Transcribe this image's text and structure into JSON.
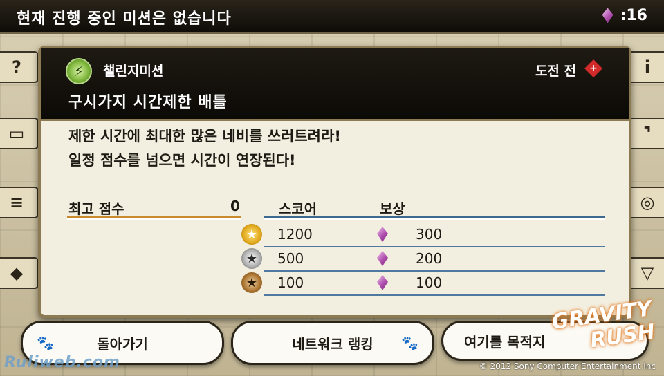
{
  "top_bar": {
    "message": "현재 진행 중인 미션은 없습니다",
    "gem_count": ":16"
  },
  "mission": {
    "type_label": "챌린지미션",
    "status_label": "도전 전",
    "title": "구시가지 시간제한 배틀",
    "description_lines": [
      "제한 시간에 최대한 많은 네비를 쓰러트려라!",
      "일정 점수를 넘으면 시간이 연장된다!"
    ]
  },
  "records": {
    "best_score_label": "최고 점수",
    "best_score_value": "0",
    "score_header": "스코어",
    "reward_header": "보상",
    "rows": [
      {
        "medal": "gold-medal-icon",
        "score": "1200",
        "reward": "300"
      },
      {
        "medal": "silver-medal-icon",
        "score": "500",
        "reward": "200"
      },
      {
        "medal": "bronze-medal-icon",
        "score": "100",
        "reward": "100"
      }
    ]
  },
  "buttons": {
    "back": "돌아가기",
    "ranking": "네트워크 랭킹",
    "target": "여기를 목적지"
  },
  "branding": {
    "logo_line1": "GRAVITY",
    "logo_line2": "RUSH",
    "watermark": "Ruliweb.com",
    "copyright": "© 2012 Sony Computer Entertainment Inc"
  },
  "colors": {
    "gem": "#b04fae",
    "best_line": "#c88a2a",
    "reward_line": "#3d6a8e"
  }
}
